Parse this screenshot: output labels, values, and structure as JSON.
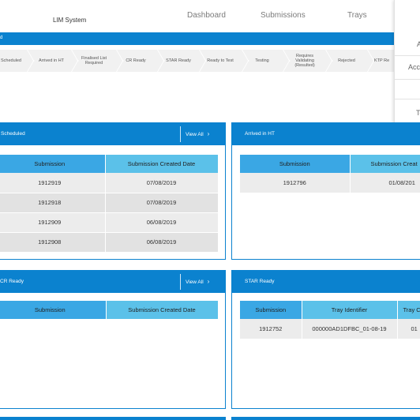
{
  "header": {
    "app_title": "LIM System",
    "nav": {
      "dashboard": "Dashboard",
      "submissions": "Submissions",
      "trays": "Trays"
    }
  },
  "bluebar": {
    "label": "d"
  },
  "workflow": {
    "steps": [
      "Scheduled",
      "Arrived in HT",
      "Finalised List Required",
      "CR Ready",
      "STAR Ready",
      "Ready to Test",
      "Testing",
      "Requires Validating (Resulted)",
      "Rejected",
      "KTP Re"
    ]
  },
  "user_menu": {
    "items": [
      "A",
      "Acc",
      "Te"
    ]
  },
  "panels": {
    "scheduled": {
      "title": "Scheduled",
      "view_all": "View All",
      "columns": [
        "Submission",
        "Submission Created Date"
      ],
      "rows": [
        [
          "1912919",
          "07/08/2019"
        ],
        [
          "1912918",
          "07/08/2019"
        ],
        [
          "1912909",
          "06/08/2019"
        ],
        [
          "1912908",
          "06/08/2019"
        ]
      ]
    },
    "arrived": {
      "title": "Arrived in HT",
      "columns": [
        "Submission",
        "Submission Creat"
      ],
      "rows": [
        [
          "1912796",
          "01/08/201"
        ]
      ]
    },
    "cr_ready": {
      "title": "CR Ready",
      "view_all": "View All",
      "columns": [
        "Submission",
        "Submission Created Date"
      ]
    },
    "star_ready": {
      "title": "STAR Ready",
      "columns": [
        "Submission",
        "Tray Identifier",
        "Tray C"
      ],
      "rows": [
        [
          "1912752",
          "000000AD1DFBC_01-08-19",
          "01"
        ]
      ]
    }
  },
  "colors": {
    "primary": "#0b82cf",
    "header_cell": "#3aa7e4",
    "header_cell_alt": "#5bc1e9",
    "row": "#ececec",
    "row_alt": "#e2e2e2"
  },
  "icons": {
    "view_all": "chevron-right-icon"
  }
}
